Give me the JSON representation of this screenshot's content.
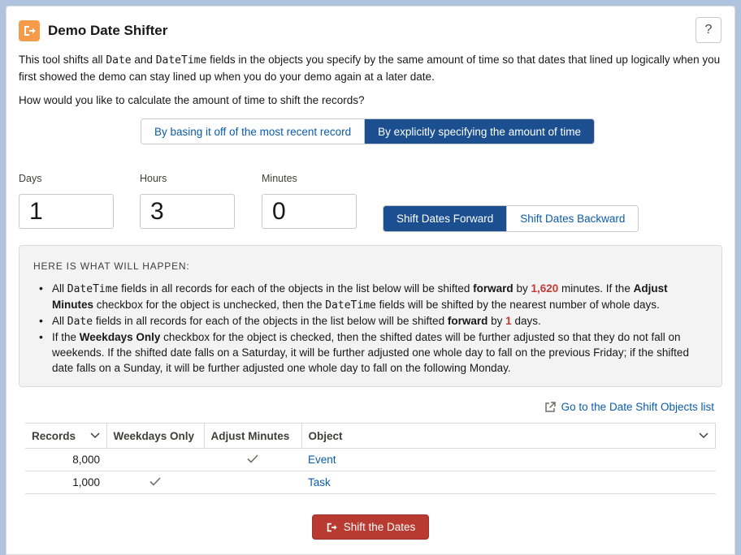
{
  "app": {
    "title": "Demo Date Shifter",
    "help_label": "?"
  },
  "intro": {
    "part1": "This tool shifts all",
    "date": "Date",
    "and": "and",
    "datetime": "DateTime",
    "part2": "fields in the objects you specify by the same amount of time so that dates that lined up logically when you first showed the demo can stay lined up when you do your demo again at a later date."
  },
  "question": "How would you like to calculate the amount of time to shift the records?",
  "calc_mode": {
    "options": [
      "By basing it off of the most recent record",
      "By explicitly specifying the amount of time"
    ],
    "selected": "By explicitly specifying the amount of time"
  },
  "fields": {
    "days": {
      "label": "Days",
      "value": "1"
    },
    "hours": {
      "label": "Hours",
      "value": "3"
    },
    "minutes": {
      "label": "Minutes",
      "value": "0"
    }
  },
  "direction": {
    "options": [
      "Shift Dates Forward",
      "Shift Dates Backward"
    ],
    "selected": "Shift Dates Forward"
  },
  "happen": {
    "title": "HERE IS WHAT WILL HAPPEN:",
    "b1": {
      "all": "All",
      "datetime": "DateTime",
      "t1": "fields in all records for each of the objects in the list below will be shifted",
      "forward": "forward",
      "by": "by",
      "minutes_value": "1,620",
      "t2": "minutes. If the",
      "adjust": "Adjust Minutes",
      "t3": "checkbox for the object is unchecked, then the",
      "datetime2": "DateTime",
      "t4": "fields will be shifted by the nearest number of whole days."
    },
    "b2": {
      "all": "All",
      "date": "Date",
      "t1": "fields in all records for each of the objects in the list below will be shifted",
      "forward": "forward",
      "by": "by",
      "days_value": "1",
      "t2": "days."
    },
    "b3": {
      "t0": "If the",
      "weekdays": "Weekdays Only",
      "t1": "checkbox for the object is checked, then the shifted dates will be further adjusted so that they do not fall on weekends. If the shifted date falls on a Saturday, it will be further adjusted one whole day to fall on the previous Friday; if the shifted date falls on a Sunday, it will be further adjusted one whole day to fall on the following Monday."
    }
  },
  "objects_link": "Go to the Date Shift Objects list",
  "table": {
    "columns": [
      "Records",
      "Weekdays Only",
      "Adjust Minutes",
      "Object"
    ],
    "rows": [
      {
        "records": "8,000",
        "weekdays_only": false,
        "adjust_minutes": true,
        "object": "Event"
      },
      {
        "records": "1,000",
        "weekdays_only": true,
        "adjust_minutes": false,
        "object": "Task"
      }
    ]
  },
  "shift_button": "Shift the Dates",
  "colors": {
    "brand": "#1b4f8f",
    "link": "#0b5cab",
    "danger": "#b83a31",
    "icon": "#f59b4a"
  }
}
